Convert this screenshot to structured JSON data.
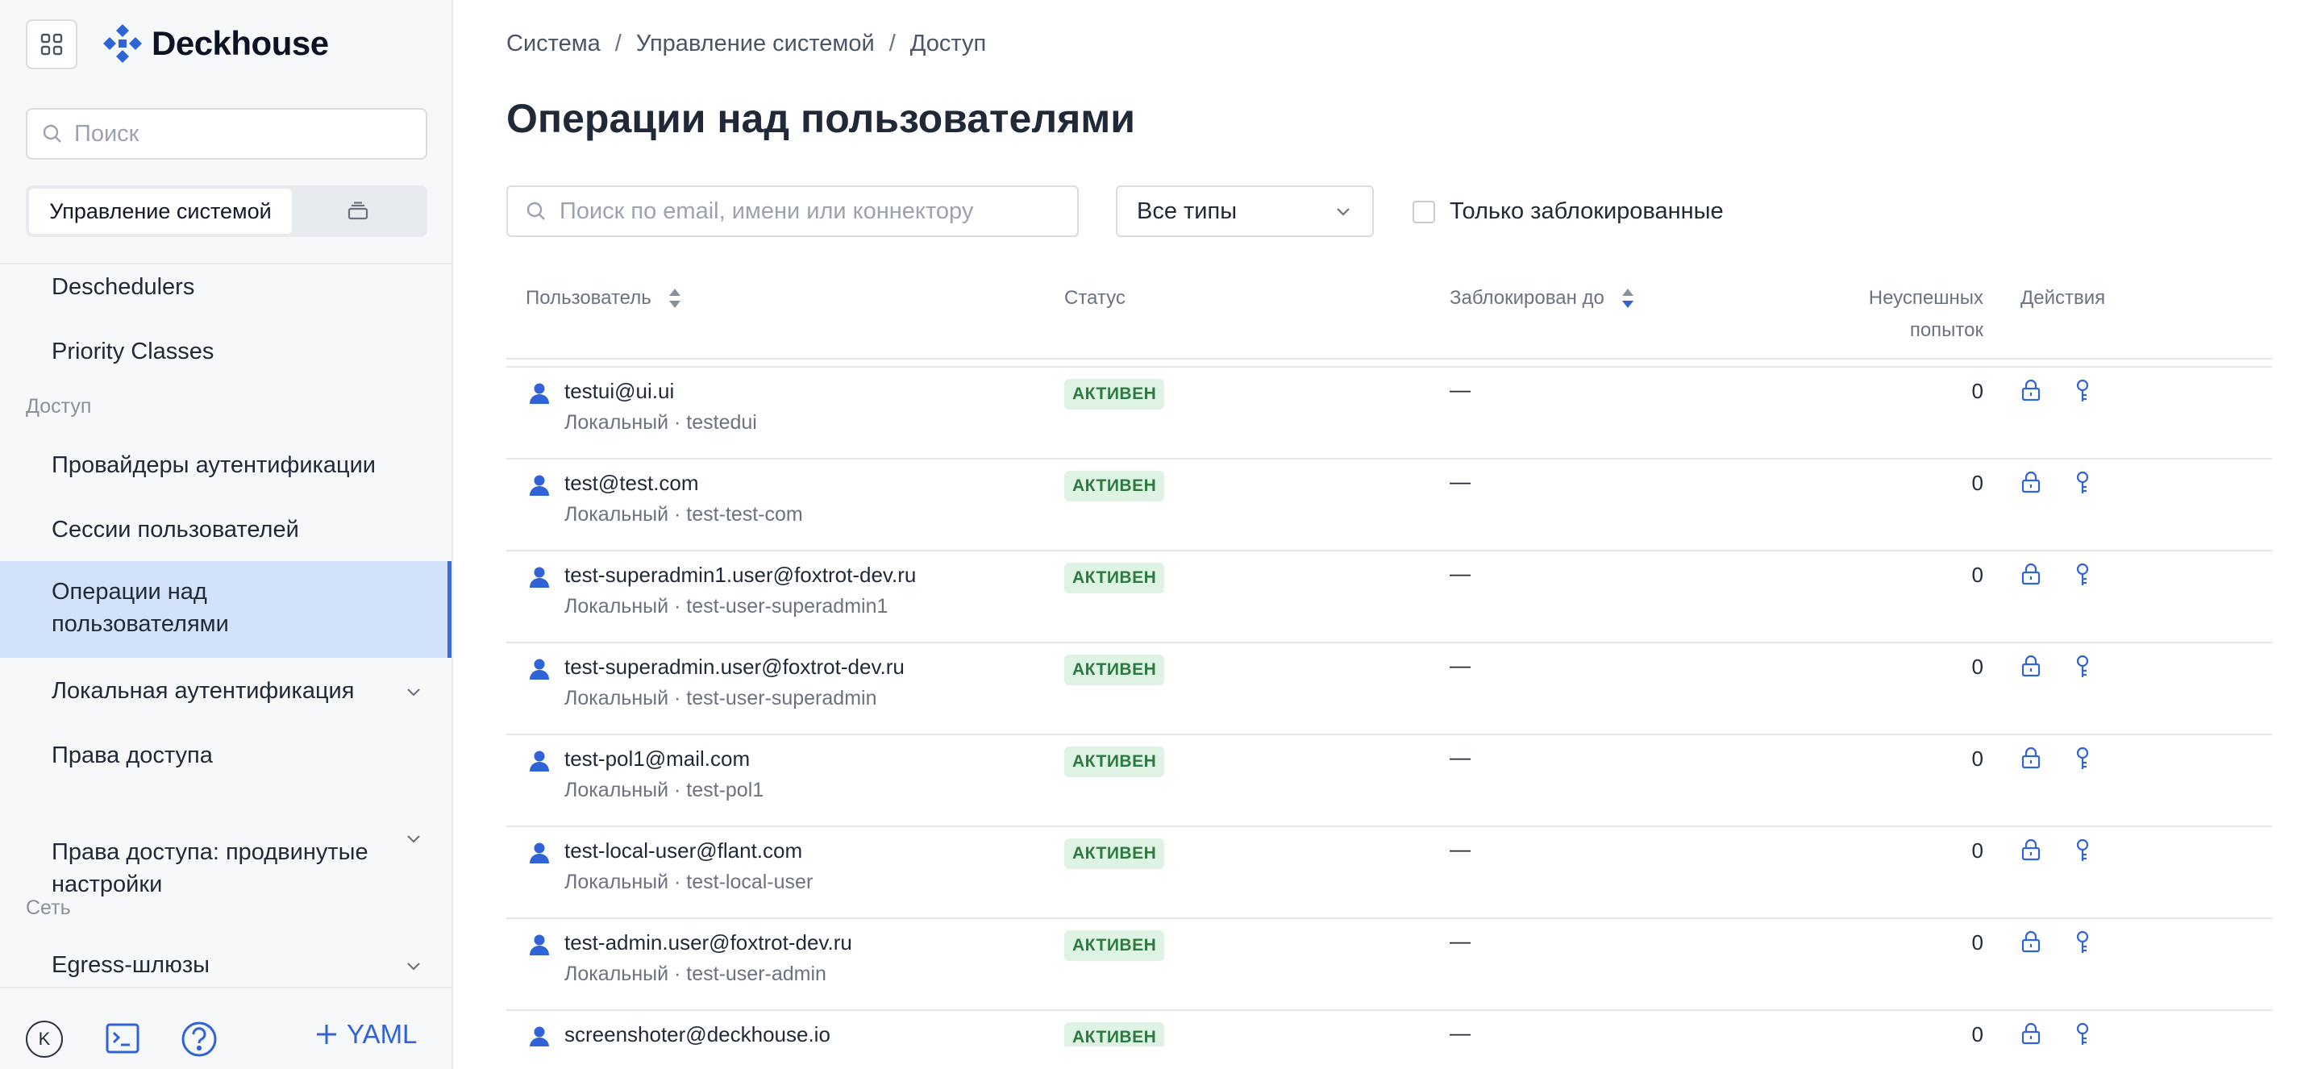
{
  "brand": {
    "name": "Deckhouse",
    "accent": "#2f63d6"
  },
  "sidebar": {
    "search_placeholder": "Поиск",
    "segment_active": "Управление системой",
    "items": [
      {
        "label": "Deschedulers",
        "type": "item"
      },
      {
        "label": "Priority Classes",
        "type": "item"
      },
      {
        "label": "Доступ",
        "type": "section"
      },
      {
        "label": "Провайдеры аутентификации",
        "type": "item"
      },
      {
        "label": "Сессии пользователей",
        "type": "item"
      },
      {
        "label": "Операции над\nпользователями",
        "type": "item",
        "active": true
      },
      {
        "label": "Локальная аутентификация",
        "type": "item",
        "expandable": true
      },
      {
        "label": "Права доступа",
        "type": "item"
      },
      {
        "label": "Права доступа: продвинутые\nнастройки",
        "type": "item",
        "expandable": true
      },
      {
        "label": "Сеть",
        "type": "section"
      },
      {
        "label": "Egress-шлюзы",
        "type": "item",
        "expandable": true
      }
    ],
    "footer": {
      "avatar_letter": "K",
      "yaml_label": "YAML"
    }
  },
  "breadcrumb": [
    "Система",
    "Управление системой",
    "Доступ"
  ],
  "page_title": "Операции над пользователями",
  "filters": {
    "search_placeholder": "Поиск по email, имени или коннектору",
    "type_select": "Все типы",
    "blocked_only_label": "Только заблокированные"
  },
  "table": {
    "columns": {
      "user": "Пользователь",
      "status": "Статус",
      "blocked_until": "Заблокирован до",
      "failed_line1": "Неуспешных",
      "failed_line2": "попыток",
      "actions": "Действия"
    },
    "rows": [
      {
        "email": "testui@ui.ui",
        "sub": "Локальный · testedui",
        "status": "АКТИВЕН",
        "blocked_until": "—",
        "failed": "0"
      },
      {
        "email": "test@test.com",
        "sub": "Локальный · test-test-com",
        "status": "АКТИВЕН",
        "blocked_until": "—",
        "failed": "0"
      },
      {
        "email": "test-superadmin1.user@foxtrot-dev.ru",
        "sub": "Локальный · test-user-superadmin1",
        "status": "АКТИВЕН",
        "blocked_until": "—",
        "failed": "0"
      },
      {
        "email": "test-superadmin.user@foxtrot-dev.ru",
        "sub": "Локальный · test-user-superadmin",
        "status": "АКТИВЕН",
        "blocked_until": "—",
        "failed": "0"
      },
      {
        "email": "test-pol1@mail.com",
        "sub": "Локальный · test-pol1",
        "status": "АКТИВЕН",
        "blocked_until": "—",
        "failed": "0"
      },
      {
        "email": "test-local-user@flant.com",
        "sub": "Локальный · test-local-user",
        "status": "АКТИВЕН",
        "blocked_until": "—",
        "failed": "0"
      },
      {
        "email": "test-admin.user@foxtrot-dev.ru",
        "sub": "Локальный · test-user-admin",
        "status": "АКТИВЕН",
        "blocked_until": "—",
        "failed": "0"
      },
      {
        "email": "screenshoter@deckhouse.io",
        "sub": "",
        "status": "АКТИВЕН",
        "blocked_until": "—",
        "failed": "0"
      }
    ]
  }
}
